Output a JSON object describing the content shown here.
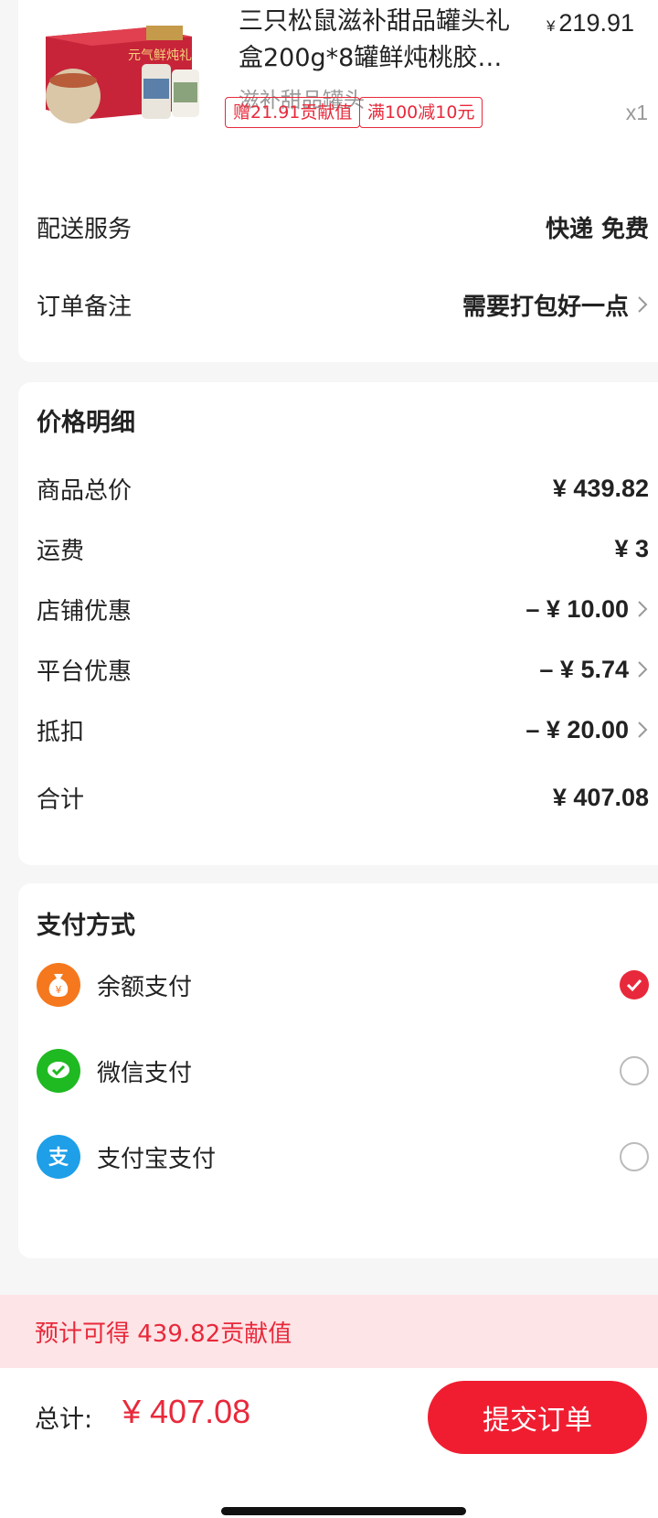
{
  "product": {
    "title": "三只松鼠滋补甜品罐头礼盒200g*8罐鲜炖桃胶…",
    "price_symbol": "¥",
    "price": "219.91",
    "subtitle": "滋补甜品罐头",
    "tags": [
      "赠21.91贡献值",
      "满100减10元"
    ],
    "quantity": "x1",
    "image_text": "元气鲜炖礼"
  },
  "delivery": {
    "label": "配送服务",
    "value": "快递 免费"
  },
  "note": {
    "label": "订单备注",
    "value": "需要打包好一点"
  },
  "price_detail": {
    "title": "价格明细",
    "rows": [
      {
        "label": "商品总价",
        "value": "¥ 439.82"
      },
      {
        "label": "运费",
        "value": "¥ 3"
      },
      {
        "label": "店铺优惠",
        "value": "– ¥ 10.00"
      },
      {
        "label": "平台优惠",
        "value": "– ¥ 5.74"
      },
      {
        "label": "抵扣",
        "value": "– ¥ 20.00"
      },
      {
        "label": "合计",
        "value": "¥ 407.08"
      }
    ]
  },
  "payment": {
    "title": "支付方式",
    "methods": [
      {
        "label": "余额支付",
        "icon": "balance-icon",
        "color": "#f5781e",
        "selected": true
      },
      {
        "label": "微信支付",
        "icon": "wechat-icon",
        "color": "#1fb922",
        "selected": false
      },
      {
        "label": "支付宝支付",
        "icon": "alipay-icon",
        "color": "#1e9fe8",
        "selected": false
      }
    ]
  },
  "banner": {
    "text": "预计可得 439.82贡献值"
  },
  "footer": {
    "total_label": "总计:",
    "total_amount": "¥ 407.08",
    "submit_label": "提交订单"
  },
  "colors": {
    "accent": "#e8293b",
    "button": "#f01d31",
    "banner_bg": "#fde4e6"
  }
}
